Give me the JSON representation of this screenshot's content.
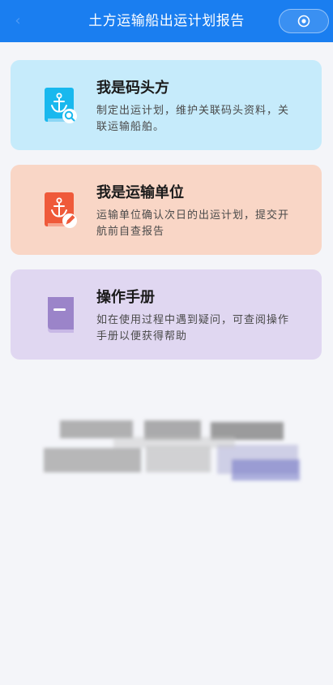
{
  "header": {
    "title": "土方运输船出运计划报告"
  },
  "cards": [
    {
      "title": "我是码头方",
      "description": "制定出运计划，维护关联码头资料，关联运输船舶。",
      "icon": "anchor-search-icon",
      "accent": "#19b8ee",
      "background": "#c6ebfb"
    },
    {
      "title": "我是运输单位",
      "description": "运输单位确认次日的出运计划，提交开航前自查报告",
      "icon": "anchor-edit-icon",
      "accent": "#ef5a3a",
      "background": "#f9d6c6"
    },
    {
      "title": "操作手册",
      "description": "如在使用过程中遇到疑问，可查阅操作手册以便获得帮助",
      "icon": "book-icon",
      "accent": "#9b84c9",
      "background": "#e0d7f1"
    }
  ],
  "colors": {
    "nav_bar": "#1a7ef0",
    "page_background": "#f4f5f9"
  }
}
